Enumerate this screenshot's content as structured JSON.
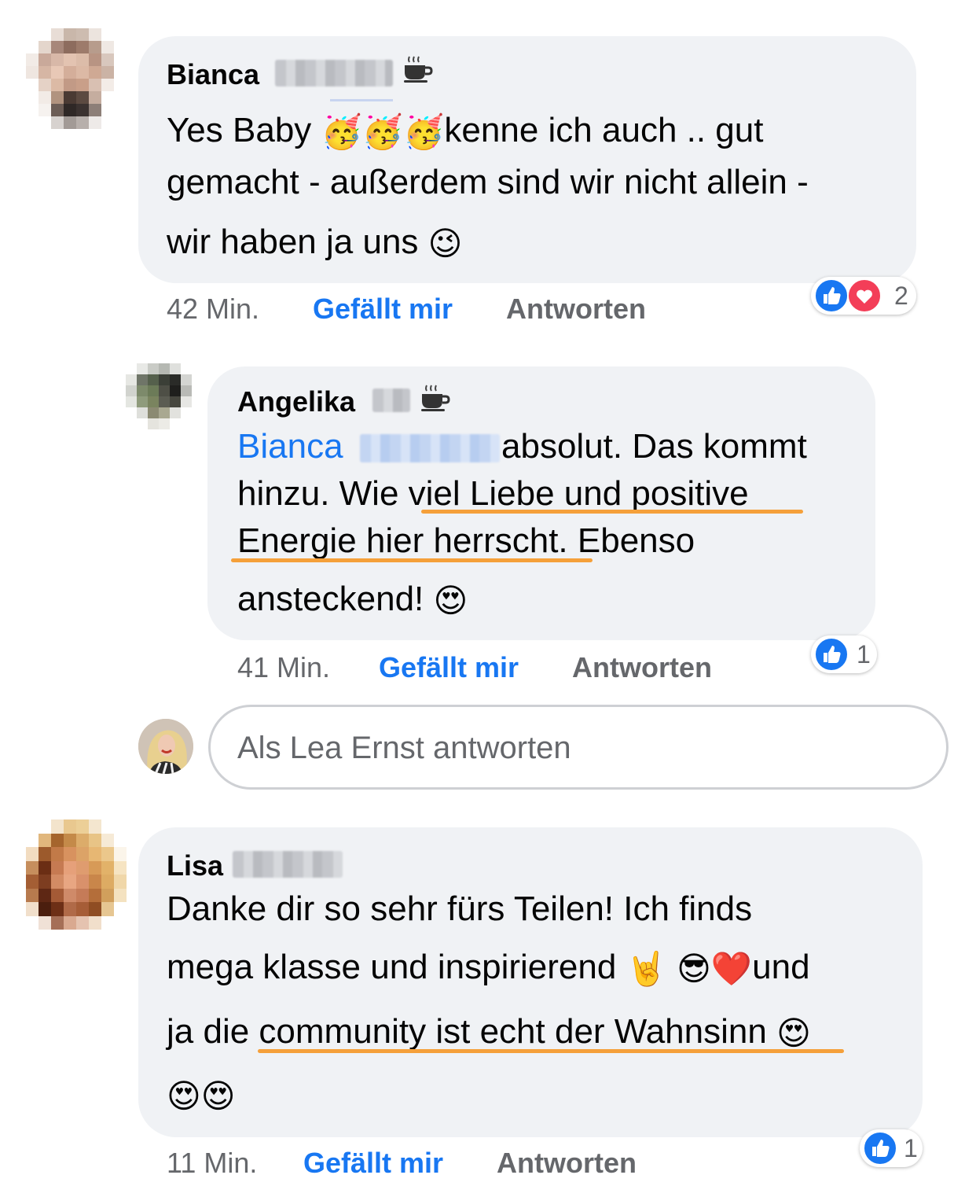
{
  "comments": [
    {
      "author_first": "Bianca",
      "badge": "coffee-cup-badge",
      "lines": [
        {
          "t1": "Yes Baby ",
          "emoji": [
            "🥳",
            "🥳",
            "🥳"
          ],
          "t2": "kenne ich auch .. gut"
        },
        {
          "text": "gemacht - außerdem sind wir nicht allein -"
        },
        {
          "text": "wir haben ja uns ",
          "emoji": [
            "😉"
          ]
        }
      ],
      "time": "42 Min.",
      "like_label": "Gefällt mir",
      "reply_label": "Antworten",
      "reaction_count": "2",
      "reactions": [
        "like-icon",
        "love-icon"
      ]
    },
    {
      "author_first": "Angelika",
      "badge": "coffee-cup-badge",
      "mention": "Bianca",
      "lines": [
        {
          "text": " absolut. Das kommt"
        },
        {
          "t1": "hinzu. Wie ",
          "u": "viel Liebe und positive"
        },
        {
          "u": "Energie hier herrscht",
          "t2": ". Ebenso"
        },
        {
          "text": "ansteckend! ",
          "emoji": [
            "😍"
          ]
        }
      ],
      "time": "41 Min.",
      "like_label": "Gefällt mir",
      "reply_label": "Antworten",
      "reaction_count": "1",
      "reactions": [
        "like-icon"
      ]
    },
    {
      "author_first": "Lisa",
      "lines": [
        {
          "text": "Danke dir so sehr fürs Teilen! Ich finds"
        },
        {
          "text": "mega klasse und inspirierend ",
          "emoji": [
            "🤘",
            "😎",
            "❤️"
          ],
          "t2": "und"
        },
        {
          "t1": "ja die ",
          "u": "community ist echt der Wahnsinn",
          "emoji": [
            "😍"
          ]
        },
        {
          "emoji": [
            "😍",
            "😍"
          ]
        }
      ],
      "time": "11 Min.",
      "like_label": "Gefällt mir",
      "reply_label": "Antworten",
      "reaction_count": "1",
      "reactions": [
        "like-icon"
      ]
    }
  ],
  "reply_input": {
    "placeholder": "Als Lea Ernst antworten"
  },
  "colors": {
    "accent": "#1877f2",
    "bubble": "#f0f2f5",
    "highlight": "#f5a03a",
    "love": "#f33e58"
  }
}
